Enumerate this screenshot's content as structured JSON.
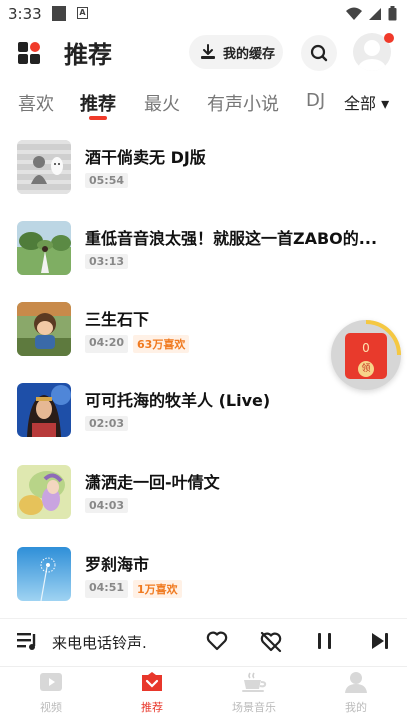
{
  "status_bar": {
    "time": "3:33"
  },
  "header": {
    "title": "推荐",
    "cache_label": "我的缓存"
  },
  "tabs": [
    {
      "label": "喜欢"
    },
    {
      "label": "推荐"
    },
    {
      "label": "最火"
    },
    {
      "label": "有声小说"
    },
    {
      "label": "DJ"
    }
  ],
  "tabs_all": "全部 ▾",
  "active_tab": "推荐",
  "songs": [
    {
      "title": "酒干倘卖无 DJ版",
      "duration": "05:54",
      "likes": ""
    },
    {
      "title": "重低音音浪太强！就服这一首ZABO的...",
      "duration": "03:13",
      "likes": ""
    },
    {
      "title": "三生石下",
      "duration": "04:20",
      "likes": "63万喜欢"
    },
    {
      "title": "可可托海的牧羊人 (Live)",
      "duration": "02:03",
      "likes": ""
    },
    {
      "title": "潇洒走一回-叶倩文",
      "duration": "04:03",
      "likes": ""
    },
    {
      "title": "罗刹海市",
      "duration": "04:51",
      "likes": "1万喜欢"
    }
  ],
  "red_envelope": {
    "count": "0",
    "seal": "领"
  },
  "player": {
    "now_playing": "来电电话铃声."
  },
  "nav": [
    {
      "label": "视频"
    },
    {
      "label": "推荐"
    },
    {
      "label": "场景音乐"
    },
    {
      "label": "我的"
    }
  ],
  "colors": {
    "accent": "#e8372b",
    "likes_text": "#f07a20"
  }
}
